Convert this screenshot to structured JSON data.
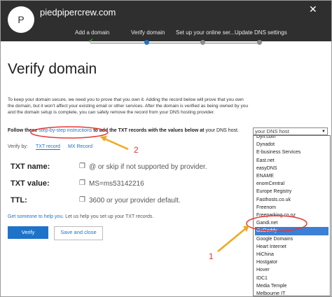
{
  "header": {
    "avatar_initial": "P",
    "domain": "piedpipercrew.com",
    "close_glyph": "✕"
  },
  "steps": [
    {
      "label": "Add a domain",
      "state": "done"
    },
    {
      "label": "Verify domain",
      "state": "current"
    },
    {
      "label": "Set up your online ser...",
      "state": "pending"
    },
    {
      "label": "Update DNS settings",
      "state": "pending"
    }
  ],
  "page": {
    "title": "Verify domain",
    "description": "To keep your domain secure, we need you to prove that you own it. Adding the record below will prove that you own the domain, but it won't affect your existing email or other services. After the domain is verified as being owned by you and the domain setup is complete, you can safely remove the record from your DNS hosting provider.",
    "follow_prefix": "Follow these",
    "follow_link": "step-by-step instructions",
    "follow_suffix_bold": "to add the TXT records with the values below at",
    "follow_suffix": "your DNS host."
  },
  "verify_by": {
    "label": "Verify by:",
    "tabs": [
      "TXT record",
      "MX Record"
    ]
  },
  "record": {
    "txt_name_label": "TXT name:",
    "txt_name_value": "@ or skip if not supported by provider.",
    "txt_value_label": "TXT value:",
    "txt_value_value": "MS=ms53142216",
    "ttl_label": "TTL:",
    "ttl_value": "3600 or your provider default."
  },
  "help": {
    "link": "Get someone to help you.",
    "text": "Let us help you set up your TXT records."
  },
  "buttons": {
    "verify": "Verify",
    "save_close": "Save and close"
  },
  "dns_select": {
    "value": "your DNS host",
    "options": [
      "Dyn.com",
      "Dynadot",
      "E-business Services",
      "East.net",
      "easyDNS",
      "ENAME",
      "enomCentral",
      "Europe Registry",
      "Fasthosts.co.uk",
      "Freenom",
      "Freeparking.co.nz",
      "Gandi.net",
      "GoDaddy",
      "Google Domains",
      "Heart Internet",
      "HiChina",
      "Hostgator",
      "Hover",
      "IDC1",
      "Media Temple",
      "Melbourne IT"
    ],
    "selected": "GoDaddy"
  },
  "annotations": {
    "arrow1_number": "1",
    "arrow2_number": "2",
    "color": "#e53935",
    "arrow_color": "#f2a81d"
  }
}
